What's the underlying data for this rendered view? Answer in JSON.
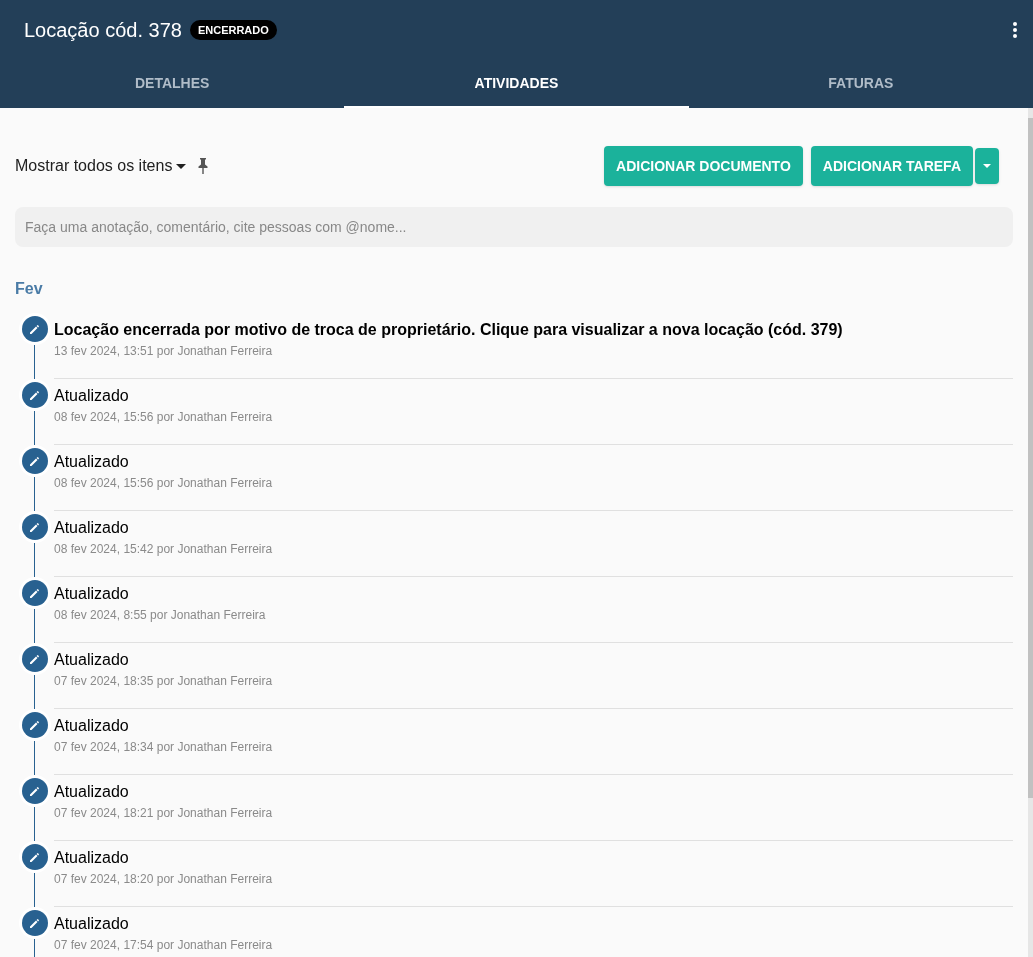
{
  "header": {
    "title": "Locação cód. 378",
    "badge": "ENCERRADO"
  },
  "tabs": [
    {
      "label": "DETALHES",
      "selected": false
    },
    {
      "label": "ATIVIDADES",
      "selected": true
    },
    {
      "label": "FATURAS",
      "selected": false
    }
  ],
  "filter": {
    "label": "Mostrar todos os itens"
  },
  "buttons": [
    "ADICIONAR DOCUMENTO",
    "ADICIONAR TAREFA"
  ],
  "comment": {
    "placeholder": "Faça uma anotação, comentário, cite pessoas com @nome..."
  },
  "month": "Fev",
  "activities": [
    {
      "title": "Locação encerrada por motivo de troca de proprietário. Clique para visualizar a nova locação (cód. 379)",
      "bold": true,
      "meta": "13 fev 2024, 13:51 por Jonathan Ferreira"
    },
    {
      "title": "Atualizado",
      "bold": false,
      "meta": "08 fev 2024, 15:56 por Jonathan Ferreira"
    },
    {
      "title": "Atualizado",
      "bold": false,
      "meta": "08 fev 2024, 15:56 por Jonathan Ferreira"
    },
    {
      "title": "Atualizado",
      "bold": false,
      "meta": "08 fev 2024, 15:42 por Jonathan Ferreira"
    },
    {
      "title": "Atualizado",
      "bold": false,
      "meta": "08 fev 2024, 8:55 por Jonathan Ferreira"
    },
    {
      "title": "Atualizado",
      "bold": false,
      "meta": "07 fev 2024, 18:35 por Jonathan Ferreira"
    },
    {
      "title": "Atualizado",
      "bold": false,
      "meta": "07 fev 2024, 18:34 por Jonathan Ferreira"
    },
    {
      "title": "Atualizado",
      "bold": false,
      "meta": "07 fev 2024, 18:21 por Jonathan Ferreira"
    },
    {
      "title": "Atualizado",
      "bold": false,
      "meta": "07 fev 2024, 18:20 por Jonathan Ferreira"
    },
    {
      "title": "Atualizado",
      "bold": false,
      "meta": "07 fev 2024, 17:54 por Jonathan Ferreira"
    }
  ]
}
